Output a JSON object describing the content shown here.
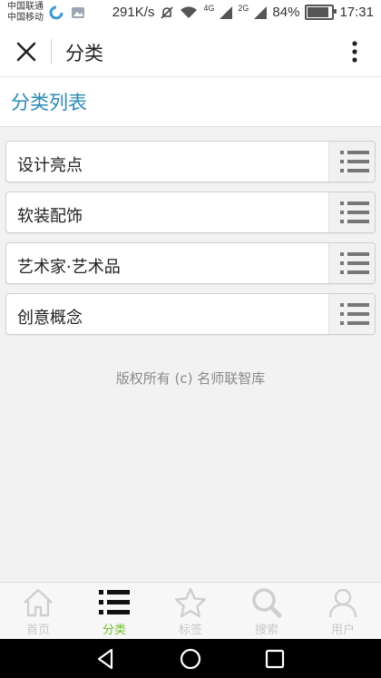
{
  "status_bar": {
    "carrier1": "中国联通",
    "carrier2": "中国移动",
    "speed": "291K/s",
    "network1": "4G",
    "network2": "2G",
    "battery": "84%",
    "time": "17:31"
  },
  "header": {
    "title": "分类"
  },
  "section": {
    "title": "分类列表"
  },
  "list": [
    {
      "label": "设计亮点"
    },
    {
      "label": "软装配饰"
    },
    {
      "label": "艺术家·艺术品"
    },
    {
      "label": "创意概念"
    }
  ],
  "footer": {
    "copyright": "版权所有 (c) 名师联智库"
  },
  "tabs": [
    {
      "label": "首页",
      "icon": "home-icon"
    },
    {
      "label": "分类",
      "icon": "list-icon",
      "active": true
    },
    {
      "label": "标签",
      "icon": "star-icon"
    },
    {
      "label": "搜索",
      "icon": "search-icon"
    },
    {
      "label": "用户",
      "icon": "user-icon"
    }
  ],
  "colors": {
    "accent": "#2b8ab7",
    "active_tab": "#6fbf2b",
    "inactive_tab": "#c8c8c8"
  }
}
